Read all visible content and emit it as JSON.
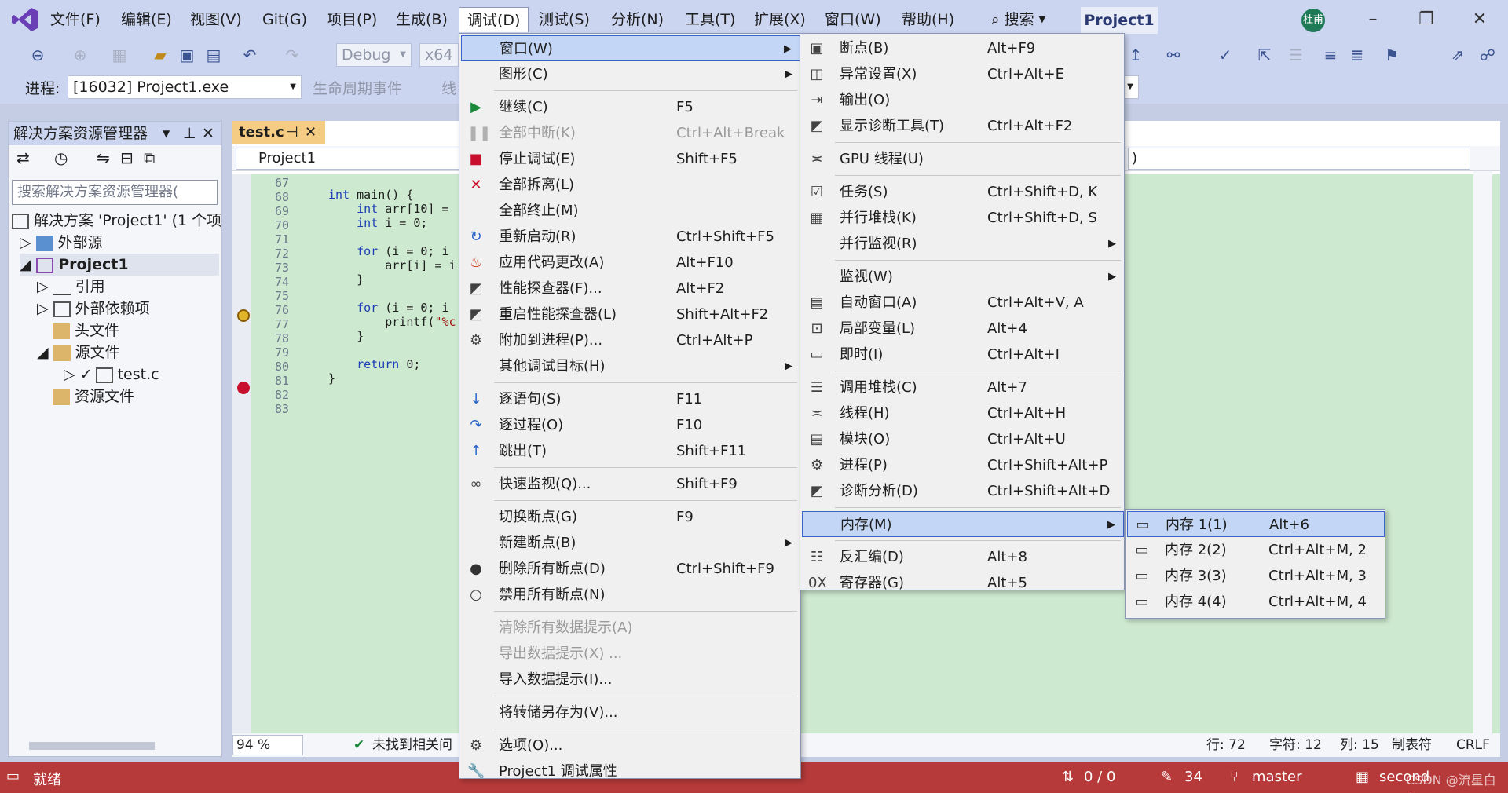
{
  "menubar": {
    "items": [
      "文件(F)",
      "编辑(E)",
      "视图(V)",
      "Git(G)",
      "项目(P)",
      "生成(B)",
      "调试(D)",
      "测试(S)",
      "分析(N)",
      "工具(T)",
      "扩展(X)",
      "窗口(W)",
      "帮助(H)"
    ],
    "search": "搜索",
    "project": "Project1",
    "avatar": "杜甫",
    "accent": "#b73a3a"
  },
  "toolbar": {
    "config": "Debug",
    "platform": "x64",
    "process_label": "进程:",
    "process": "[16032] Project1.exe",
    "lifecycle": "生命周期事件",
    "thread": "线"
  },
  "solution": {
    "title": "解决方案资源管理器",
    "search_placeholder": "搜索解决方案资源管理器(",
    "nodes": [
      "解决方案 'Project1' (1 个项",
      "外部源",
      "Project1",
      "引用",
      "外部依赖项",
      "头文件",
      "源文件",
      "test.c",
      "资源文件"
    ]
  },
  "editor": {
    "tab": "test.c",
    "nav": "Project1",
    "nav_right": ")",
    "line_numbers": [
      "67",
      "68",
      "69",
      "70",
      "71",
      "72",
      "73",
      "74",
      "75",
      "76",
      "77",
      "78",
      "79",
      "80",
      "81",
      "82",
      "83"
    ],
    "zoom": "94 %",
    "status_msg": "未找到相关问",
    "row": "行: 72",
    "char": "字符: 12",
    "col": "列: 15",
    "tab_mode": "制表符",
    "eol": "CRLF"
  },
  "status": {
    "ready": "就绪",
    "changes": "0 / 0",
    "pencil": "34",
    "branch": "master",
    "repo": "second"
  },
  "debug_menu": [
    {
      "label": "窗口(W)",
      "shortcut": "",
      "sub": true,
      "icon": ""
    },
    {
      "label": "图形(C)",
      "shortcut": "",
      "sub": true,
      "icon": ""
    },
    {
      "label": "继续(C)",
      "shortcut": "F5",
      "icon": "play-icon"
    },
    {
      "label": "全部中断(K)",
      "shortcut": "Ctrl+Alt+Break",
      "disabled": true,
      "icon": "pause-icon"
    },
    {
      "label": "停止调试(E)",
      "shortcut": "Shift+F5",
      "icon": "stop-icon"
    },
    {
      "label": "全部拆离(L)",
      "shortcut": "",
      "icon": "detach-icon"
    },
    {
      "label": "全部终止(M)",
      "shortcut": "",
      "icon": ""
    },
    {
      "label": "重新启动(R)",
      "shortcut": "Ctrl+Shift+F5",
      "icon": "restart-icon"
    },
    {
      "label": "应用代码更改(A)",
      "shortcut": "Alt+F10",
      "icon": "hot-reload-icon"
    },
    {
      "label": "性能探查器(F)...",
      "shortcut": "Alt+F2",
      "icon": "profiler-icon"
    },
    {
      "label": "重启性能探查器(L)",
      "shortcut": "Shift+Alt+F2",
      "icon": "profiler-icon"
    },
    {
      "label": "附加到进程(P)...",
      "shortcut": "Ctrl+Alt+P",
      "icon": "attach-icon"
    },
    {
      "label": "其他调试目标(H)",
      "shortcut": "",
      "sub": true,
      "icon": ""
    },
    {
      "label": "逐语句(S)",
      "shortcut": "F11",
      "icon": "step-into-icon"
    },
    {
      "label": "逐过程(O)",
      "shortcut": "F10",
      "icon": "step-over-icon"
    },
    {
      "label": "跳出(T)",
      "shortcut": "Shift+F11",
      "icon": "step-out-icon"
    },
    {
      "label": "快速监视(Q)...",
      "shortcut": "Shift+F9",
      "icon": "glasses-icon"
    },
    {
      "label": "切换断点(G)",
      "shortcut": "F9",
      "icon": ""
    },
    {
      "label": "新建断点(B)",
      "shortcut": "",
      "sub": true,
      "icon": ""
    },
    {
      "label": "删除所有断点(D)",
      "shortcut": "Ctrl+Shift+F9",
      "icon": "delete-breakpoints-icon"
    },
    {
      "label": "禁用所有断点(N)",
      "shortcut": "",
      "icon": "disable-breakpoints-icon"
    },
    {
      "label": "清除所有数据提示(A)",
      "shortcut": "",
      "disabled": true,
      "icon": ""
    },
    {
      "label": "导出数据提示(X) ...",
      "shortcut": "",
      "disabled": true,
      "icon": ""
    },
    {
      "label": "导入数据提示(I)...",
      "shortcut": "",
      "icon": ""
    },
    {
      "label": "将转储另存为(V)...",
      "shortcut": "",
      "icon": ""
    },
    {
      "label": "选项(O)...",
      "shortcut": "",
      "icon": "gear-icon"
    },
    {
      "label": "Project1 调试属性",
      "shortcut": "",
      "icon": "wrench-icon"
    }
  ],
  "window_menu": [
    {
      "label": "断点(B)",
      "shortcut": "Alt+F9",
      "icon": "breakpoints-icon"
    },
    {
      "label": "异常设置(X)",
      "shortcut": "Ctrl+Alt+E",
      "icon": "exception-icon"
    },
    {
      "label": "输出(O)",
      "shortcut": "",
      "icon": "output-icon"
    },
    {
      "label": "显示诊断工具(T)",
      "shortcut": "Ctrl+Alt+F2",
      "icon": "diagnostics-icon"
    },
    {
      "label": "GPU 线程(U)",
      "shortcut": "",
      "icon": "gpu-threads-icon"
    },
    {
      "label": "任务(S)",
      "shortcut": "Ctrl+Shift+D, K",
      "icon": "tasks-icon"
    },
    {
      "label": "并行堆栈(K)",
      "shortcut": "Ctrl+Shift+D, S",
      "icon": "parallel-stacks-icon"
    },
    {
      "label": "并行监视(R)",
      "shortcut": "",
      "sub": true,
      "icon": ""
    },
    {
      "label": "监视(W)",
      "shortcut": "",
      "sub": true,
      "icon": ""
    },
    {
      "label": "自动窗口(A)",
      "shortcut": "Ctrl+Alt+V, A",
      "icon": "autos-icon"
    },
    {
      "label": "局部变量(L)",
      "shortcut": "Alt+4",
      "icon": "locals-icon"
    },
    {
      "label": "即时(I)",
      "shortcut": "Ctrl+Alt+I",
      "icon": "immediate-icon"
    },
    {
      "label": "调用堆栈(C)",
      "shortcut": "Alt+7",
      "icon": "call-stack-icon"
    },
    {
      "label": "线程(H)",
      "shortcut": "Ctrl+Alt+H",
      "icon": "threads-icon"
    },
    {
      "label": "模块(O)",
      "shortcut": "Ctrl+Alt+U",
      "icon": "modules-icon"
    },
    {
      "label": "进程(P)",
      "shortcut": "Ctrl+Shift+Alt+P",
      "icon": "processes-icon"
    },
    {
      "label": "诊断分析(D)",
      "shortcut": "Ctrl+Shift+Alt+D",
      "icon": "diagnostic-analysis-icon"
    },
    {
      "label": "内存(M)",
      "shortcut": "",
      "sub": true,
      "icon": ""
    },
    {
      "label": "反汇编(D)",
      "shortcut": "Alt+8",
      "icon": "disassembly-icon"
    },
    {
      "label": "寄存器(G)",
      "shortcut": "Alt+5",
      "icon": "registers-icon"
    }
  ],
  "memory_menu": [
    {
      "label": "内存 1(1)",
      "shortcut": "Alt+6"
    },
    {
      "label": "内存 2(2)",
      "shortcut": "Ctrl+Alt+M, 2"
    },
    {
      "label": "内存 3(3)",
      "shortcut": "Ctrl+Alt+M, 3"
    },
    {
      "label": "内存 4(4)",
      "shortcut": "Ctrl+Alt+M, 4"
    }
  ],
  "watermark": "CSDN @流星白龙"
}
